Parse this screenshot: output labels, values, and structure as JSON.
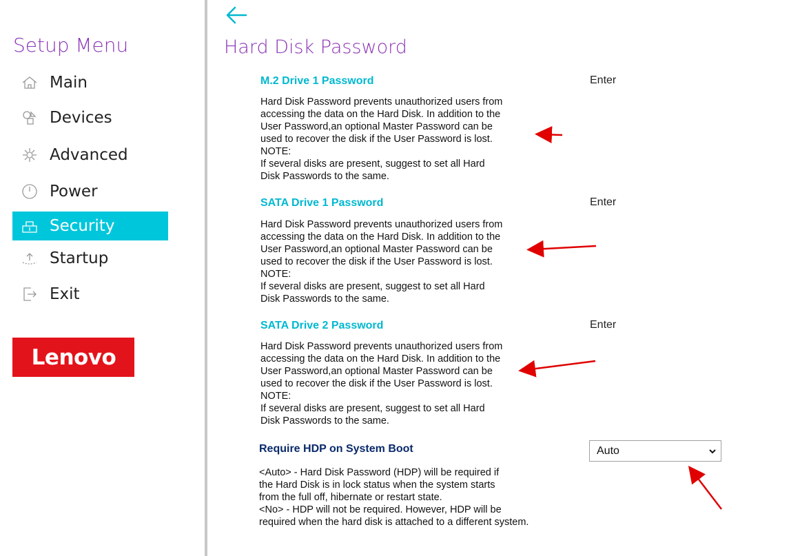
{
  "sidebar": {
    "title": "Setup Menu",
    "items": [
      {
        "label": "Main",
        "icon": "home-icon",
        "active": false
      },
      {
        "label": "Devices",
        "icon": "devices-icon",
        "active": false
      },
      {
        "label": "Advanced",
        "icon": "advanced-icon",
        "active": false
      },
      {
        "label": "Power",
        "icon": "power-icon",
        "active": false
      },
      {
        "label": "Security",
        "icon": "security-icon",
        "active": true
      },
      {
        "label": "Startup",
        "icon": "startup-icon",
        "active": false
      },
      {
        "label": "Exit",
        "icon": "exit-icon",
        "active": false
      }
    ],
    "logo": "Lenovo"
  },
  "colors": {
    "accent": "#00c6dc",
    "title_purple": "#8b34b5",
    "setting_cyan": "#00b8d0",
    "setting_dark": "#0a2a6b",
    "logo_red": "#e3131b",
    "annotation_red": "#e00000"
  },
  "main": {
    "page_title": "Hard Disk Password",
    "settings": [
      {
        "title": "M.2 Drive 1 Password",
        "value": "Enter",
        "description": [
          "Hard Disk Password prevents unauthorized users from",
          "accessing the data on the Hard Disk. In addition to the",
          "User Password,an optional Master Password can be",
          "used to recover the disk if the User Password is lost.",
          "NOTE:",
          "If several disks are present, suggest to set all Hard",
          "Disk Passwords to the same."
        ]
      },
      {
        "title": "SATA Drive 1 Password",
        "value": "Enter",
        "description": [
          "Hard Disk Password prevents unauthorized users from",
          "accessing the data on the Hard Disk. In addition to the",
          "User Password,an optional Master Password can be",
          "used to recover the disk if the User Password is lost.",
          "NOTE:",
          "If several disks are present, suggest to set all Hard",
          "Disk Passwords to the same."
        ]
      },
      {
        "title": "SATA Drive 2 Password",
        "value": "Enter",
        "description": [
          "Hard Disk Password prevents unauthorized users from",
          "accessing the data on the Hard Disk. In addition to the",
          "User Password,an optional Master Password can be",
          "used to recover the disk if the User Password is lost.",
          "NOTE:",
          "If several disks are present, suggest to set all Hard",
          "Disk Passwords to the same."
        ]
      },
      {
        "title": "Require HDP on System Boot",
        "selected": "Auto",
        "description": [
          "<Auto> - Hard Disk Password (HDP) will be required if",
          "the Hard Disk is in lock status when the system starts",
          "from the full off, hibernate or restart state.",
          "<No> - HDP will not be required. However, HDP will be",
          "required when the hard disk is attached to a different system."
        ]
      }
    ]
  }
}
